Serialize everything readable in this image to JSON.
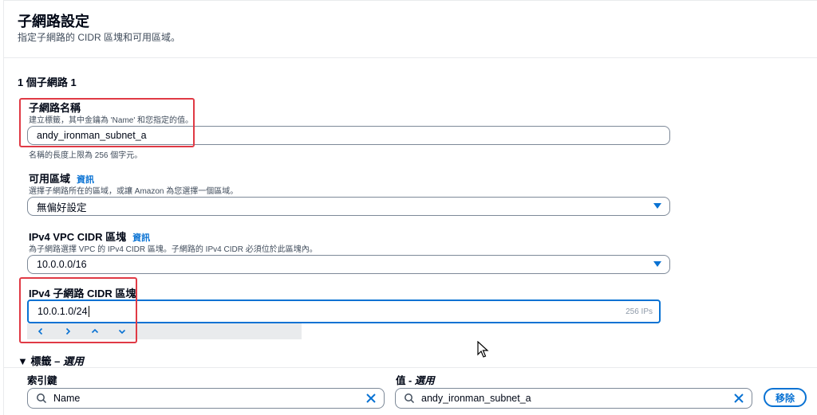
{
  "header": {
    "title": "子網路設定",
    "description": "指定子網路的 CIDR 區塊和可用區域。"
  },
  "subnet": {
    "heading": "1 個子網路 1",
    "name": {
      "label": "子網路名稱",
      "description": "建立標籤，其中金鑰為 'Name' 和您指定的值。",
      "value": "andy_ironman_subnet_a",
      "constraint": "名稱的長度上限為 256 個字元。"
    },
    "az": {
      "label": "可用區域",
      "info": "資訊",
      "description": "選擇子網路所在的區域，或讓 Amazon 為您選擇一個區域。",
      "value": "無偏好設定"
    },
    "vpc_cidr": {
      "label": "IPv4 VPC CIDR 區塊",
      "info": "資訊",
      "description": "為子網路選擇 VPC 的 IPv4 CIDR 區塊。子網路的 IPv4 CIDR 必須位於此區塊內。",
      "value": "10.0.0.0/16"
    },
    "subnet_cidr": {
      "label": "IPv4 子網路 CIDR 區塊",
      "value": "10.0.1.0/24",
      "suffix": "256 IPs"
    }
  },
  "tags": {
    "heading": "標籤 – ",
    "heading_optional": "選用",
    "key_label": "索引鍵",
    "value_label": "值 - ",
    "value_optional": "選用",
    "key_value": "Name",
    "value_value": "andy_ironman_subnet_a",
    "remove_label": "移除"
  },
  "icons": [
    "chevron-left-icon",
    "chevron-right-icon",
    "chevron-up-icon",
    "chevron-down-icon",
    "caret-down-icon",
    "search-icon",
    "clear-icon",
    "mouse-pointer-icon"
  ],
  "colors": {
    "accent": "#0972d3",
    "highlight": "#e03a45",
    "border": "#7d8998"
  }
}
